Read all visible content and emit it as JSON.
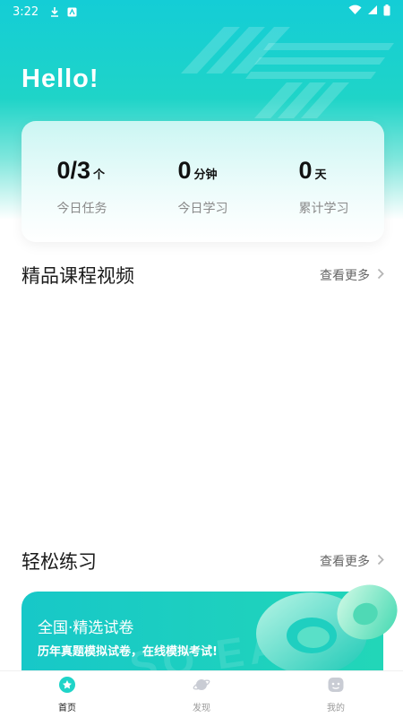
{
  "status_bar": {
    "time": "3:22"
  },
  "header": {
    "greeting": "Hello!"
  },
  "stats": [
    {
      "value": "0/3",
      "unit": "个",
      "label": "今日任务"
    },
    {
      "value": "0",
      "unit": "分钟",
      "label": "今日学习"
    },
    {
      "value": "0",
      "unit": "天",
      "label": "累计学习"
    }
  ],
  "courses_section": {
    "title": "精品课程视频",
    "more_label": "查看更多"
  },
  "practice_section": {
    "title": "轻松练习",
    "more_label": "查看更多"
  },
  "exam_card": {
    "title": "全国·精选试卷",
    "subtitle": "历年真题模拟试卷，在线模拟考试!",
    "watermark": "SO EASY"
  },
  "bottom_nav": [
    {
      "label": "首页",
      "icon": "home-icon",
      "active": true
    },
    {
      "label": "发现",
      "icon": "planet-icon",
      "active": false
    },
    {
      "label": "我的",
      "icon": "profile-face-icon",
      "active": false
    }
  ],
  "colors": {
    "accent": "#1fd4c8",
    "accent_dark": "#0bb7c2",
    "text": "#1b1b1b",
    "muted": "#8a8a8a"
  }
}
